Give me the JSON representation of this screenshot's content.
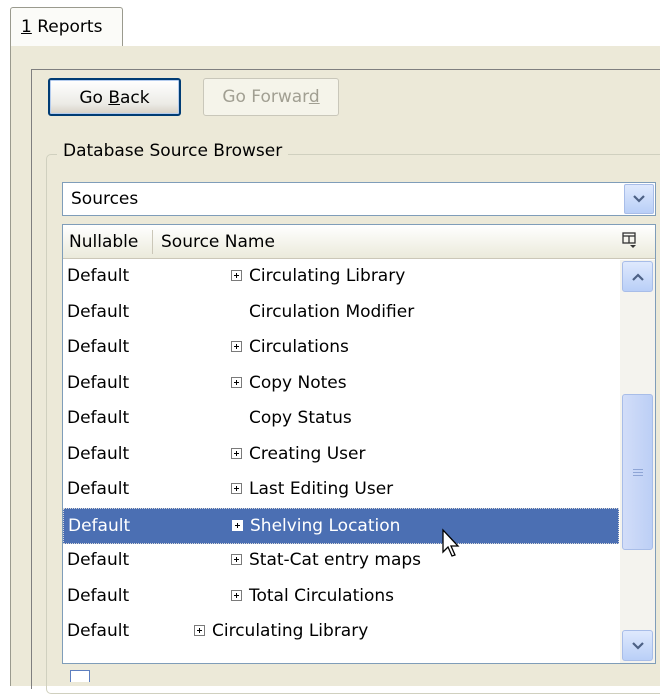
{
  "tab": {
    "accel": "1",
    "label": " Reports"
  },
  "buttons": {
    "go_back": {
      "pre": "Go ",
      "accel": "B",
      "post": "ack"
    },
    "go_forward": {
      "pre": "Go Forwar",
      "accel": "d",
      "post": ""
    }
  },
  "group": {
    "legend": "Database Source Browser"
  },
  "combo": {
    "value": "Sources"
  },
  "tree": {
    "columns": [
      "Nullable",
      "Source Name"
    ],
    "rows": [
      {
        "nullable": "Default",
        "name": "Circulating Library",
        "expandable": true,
        "indent": 2
      },
      {
        "nullable": "Default",
        "name": "Circulation Modifier",
        "expandable": false,
        "indent": 2
      },
      {
        "nullable": "Default",
        "name": "Circulations",
        "expandable": true,
        "indent": 2
      },
      {
        "nullable": "Default",
        "name": "Copy Notes",
        "expandable": true,
        "indent": 2
      },
      {
        "nullable": "Default",
        "name": "Copy Status",
        "expandable": false,
        "indent": 2
      },
      {
        "nullable": "Default",
        "name": "Creating User",
        "expandable": true,
        "indent": 2
      },
      {
        "nullable": "Default",
        "name": "Last Editing User",
        "expandable": true,
        "indent": 2
      },
      {
        "nullable": "Default",
        "name": "Shelving Location",
        "expandable": true,
        "indent": 2,
        "selected": true
      },
      {
        "nullable": "Default",
        "name": "Stat-Cat entry maps",
        "expandable": true,
        "indent": 2
      },
      {
        "nullable": "Default",
        "name": "Total Circulations",
        "expandable": true,
        "indent": 2
      },
      {
        "nullable": "Default",
        "name": "Circulating Library",
        "expandable": true,
        "indent": 1
      }
    ]
  },
  "icons": {
    "dropdown": "chevron-down-icon",
    "column_picker": "column-picker-icon",
    "scroll_up": "chevron-up-icon",
    "scroll_down": "chevron-down-icon",
    "expand": "plus-box-icon",
    "cursor": "mouse-pointer-icon"
  },
  "colors": {
    "selection": "#4b6fb3",
    "panel": "#ece9d8",
    "default_button_border": "#003c74",
    "disabled_text": "#a19f92"
  }
}
